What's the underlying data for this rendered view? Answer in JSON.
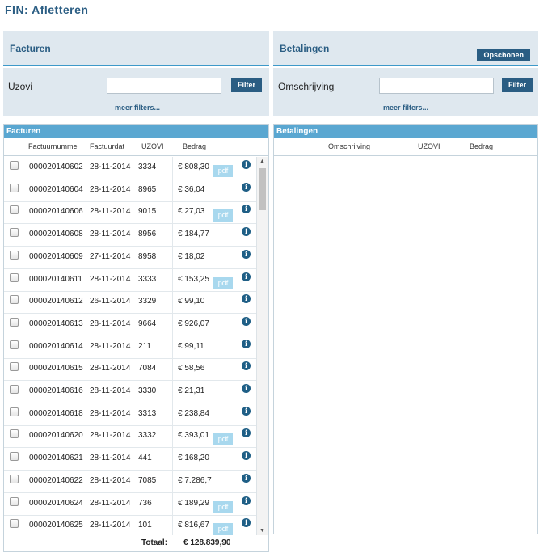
{
  "page": {
    "title": "FIN: Afletteren"
  },
  "left": {
    "panel_title": "Facturen",
    "filter_label": "Uzovi",
    "filter_value": "",
    "filter_button": "Filter",
    "more_filters": "meer filters...",
    "grid_title": "Facturen",
    "columns": [
      "Factuurnumme",
      "Factuurdat",
      "UZOVI",
      "Bedrag"
    ],
    "rows": [
      {
        "nr": "000020140602",
        "date": "28-11-2014",
        "uzovi": "3334",
        "amount": "€ 808,30",
        "pdf": "pdf"
      },
      {
        "nr": "000020140604",
        "date": "28-11-2014",
        "uzovi": "8965",
        "amount": "€ 36,04",
        "pdf": ""
      },
      {
        "nr": "000020140606",
        "date": "28-11-2014",
        "uzovi": "9015",
        "amount": "€ 27,03",
        "pdf": "pdf"
      },
      {
        "nr": "000020140608",
        "date": "28-11-2014",
        "uzovi": "8956",
        "amount": "€ 184,77",
        "pdf": ""
      },
      {
        "nr": "000020140609",
        "date": "27-11-2014",
        "uzovi": "8958",
        "amount": "€ 18,02",
        "pdf": ""
      },
      {
        "nr": "000020140611",
        "date": "28-11-2014",
        "uzovi": "3333",
        "amount": "€ 153,25",
        "pdf": "pdf"
      },
      {
        "nr": "000020140612",
        "date": "26-11-2014",
        "uzovi": "3329",
        "amount": "€ 99,10",
        "pdf": ""
      },
      {
        "nr": "000020140613",
        "date": "28-11-2014",
        "uzovi": "9664",
        "amount": "€ 926,07",
        "pdf": ""
      },
      {
        "nr": "000020140614",
        "date": "28-11-2014",
        "uzovi": "211",
        "amount": "€ 99,11",
        "pdf": ""
      },
      {
        "nr": "000020140615",
        "date": "28-11-2014",
        "uzovi": "7084",
        "amount": "€ 58,56",
        "pdf": ""
      },
      {
        "nr": "000020140616",
        "date": "28-11-2014",
        "uzovi": "3330",
        "amount": "€ 21,31",
        "pdf": ""
      },
      {
        "nr": "000020140618",
        "date": "28-11-2014",
        "uzovi": "3313",
        "amount": "€ 238,84",
        "pdf": ""
      },
      {
        "nr": "000020140620",
        "date": "28-11-2014",
        "uzovi": "3332",
        "amount": "€ 393,01",
        "pdf": "pdf"
      },
      {
        "nr": "000020140621",
        "date": "28-11-2014",
        "uzovi": "441",
        "amount": "€ 168,20",
        "pdf": ""
      },
      {
        "nr": "000020140622",
        "date": "28-11-2014",
        "uzovi": "7085",
        "amount": "€ 7.286,7",
        "pdf": ""
      },
      {
        "nr": "000020140624",
        "date": "28-11-2014",
        "uzovi": "736",
        "amount": "€ 189,29",
        "pdf": "pdf"
      },
      {
        "nr": "000020140625",
        "date": "28-11-2014",
        "uzovi": "101",
        "amount": "€ 816,67",
        "pdf": "pdf"
      }
    ],
    "total_label": "Totaal:",
    "total_value": "€ 128.839,90"
  },
  "right": {
    "panel_title": "Betalingen",
    "clear_button": "Opschonen",
    "filter_label": "Omschrijving",
    "filter_value": "",
    "filter_button": "Filter",
    "more_filters": "meer filters...",
    "grid_title": "Betalingen",
    "columns": [
      "Omschrijving",
      "UZOVI",
      "Bedrag"
    ]
  },
  "icons": {
    "info": "info-icon",
    "checkbox": "checkbox",
    "scroll_up": "scroll-up-arrow",
    "scroll_down": "scroll-down-arrow"
  },
  "colors": {
    "accent": "#2a5d83",
    "header_bg": "#dfe8ef",
    "grid_title_bg": "#5aa7d1",
    "pdf_badge": "#a8d8ee"
  }
}
